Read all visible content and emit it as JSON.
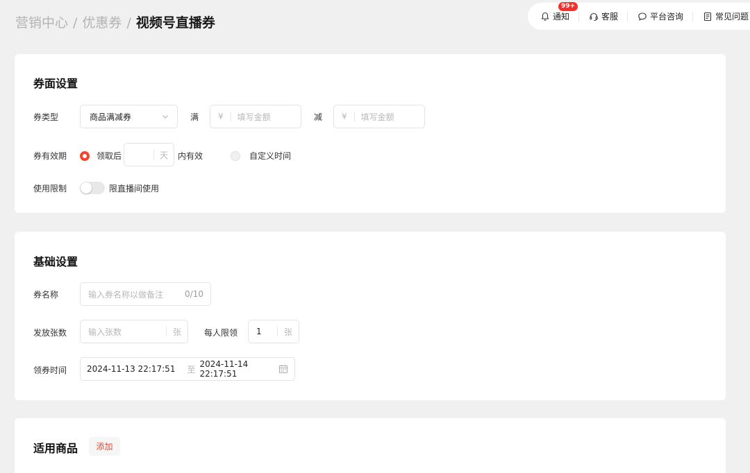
{
  "breadcrumb": {
    "items": [
      "营销中心",
      "优惠券"
    ],
    "current": "视频号直播券",
    "separator": "/"
  },
  "topnav": {
    "notify": {
      "label": "通知",
      "badge": "99+"
    },
    "service": {
      "label": "客服"
    },
    "consult": {
      "label": "平台咨询"
    },
    "faq": {
      "label": "常见问题"
    }
  },
  "coupon_face": {
    "title": "券面设置",
    "type": {
      "label": "券类型",
      "selected": "商品满减券"
    },
    "full": {
      "label": "满",
      "currency": "¥",
      "placeholder": "填写金额"
    },
    "minus": {
      "label": "减",
      "currency": "¥",
      "placeholder": "填写金额"
    },
    "validity": {
      "label": "券有效期",
      "option_after": "领取后",
      "days_unit": "天",
      "option_after_suffix": "内有效",
      "option_custom": "自定义时间",
      "selected": "after"
    },
    "restriction": {
      "label": "使用限制",
      "toggle_label": "限直播间使用",
      "enabled": false
    }
  },
  "basic": {
    "title": "基础设置",
    "name": {
      "label": "券名称",
      "placeholder": "输入券名称以做备注",
      "counter": "0/10"
    },
    "quantity": {
      "label": "发放张数",
      "placeholder": "输入张数",
      "unit": "张"
    },
    "per_person": {
      "label": "每人限领",
      "value": "1",
      "unit": "张"
    },
    "time": {
      "label": "领券时间",
      "start": "2024-11-13 22:17:51",
      "to": "至",
      "end": "2024-11-14 22:17:51"
    }
  },
  "products": {
    "title": "适用商品",
    "add_label": "添加"
  },
  "colors": {
    "accent": "#f5452c",
    "badge": "#f5302c",
    "background": "#f0f0f0"
  }
}
